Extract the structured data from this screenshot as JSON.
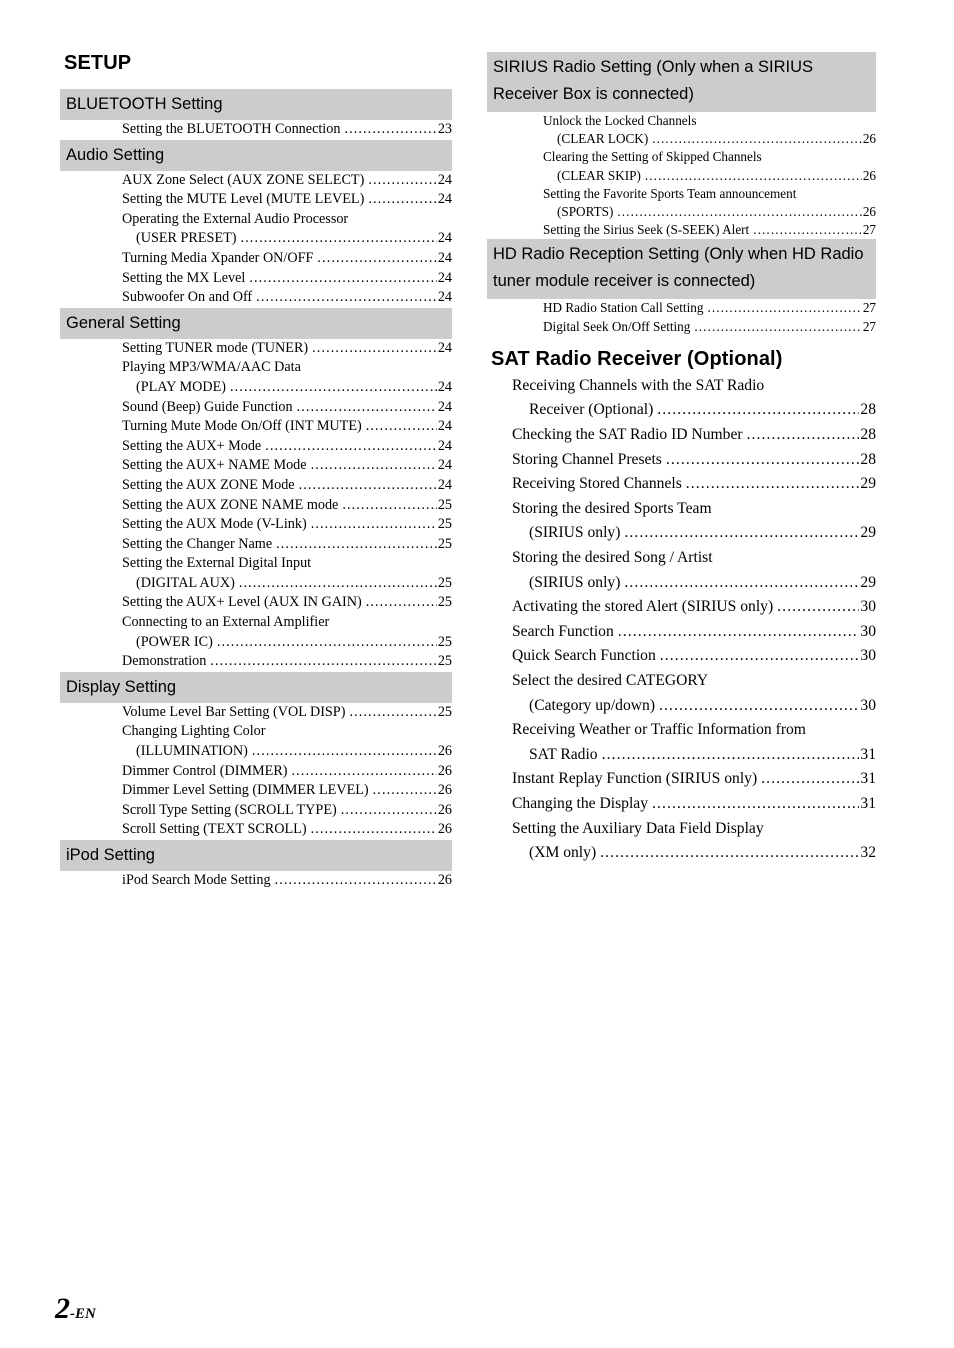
{
  "page": {
    "folio_number": "2",
    "folio_suffix": "-EN",
    "band_color": "#cccccc"
  },
  "left_column": {
    "chapter_title": "SETUP",
    "sections": [
      {
        "heading": "BLUETOOTH Setting",
        "entries": [
          {
            "lines": [
              "Setting the BLUETOOTH Connection"
            ],
            "page": "23"
          }
        ]
      },
      {
        "heading": "Audio Setting",
        "entries": [
          {
            "lines": [
              "AUX Zone Select (AUX ZONE SELECT)"
            ],
            "page": "24"
          },
          {
            "lines": [
              "Setting the MUTE Level (MUTE LEVEL)"
            ],
            "page": "24"
          },
          {
            "lines": [
              "Operating the External Audio Processor",
              "(USER PRESET)"
            ],
            "page": "24"
          },
          {
            "lines": [
              "Turning Media Xpander ON/OFF"
            ],
            "page": "24"
          },
          {
            "lines": [
              "Setting the MX Level"
            ],
            "page": "24"
          },
          {
            "lines": [
              "Subwoofer On and Off"
            ],
            "page": "24"
          }
        ]
      },
      {
        "heading": "General Setting",
        "entries": [
          {
            "lines": [
              "Setting TUNER mode (TUNER)"
            ],
            "page": "24"
          },
          {
            "lines": [
              "Playing MP3/WMA/AAC Data",
              "(PLAY MODE)"
            ],
            "page": "24"
          },
          {
            "lines": [
              "Sound (Beep) Guide Function"
            ],
            "page": "24"
          },
          {
            "lines": [
              "Turning Mute Mode On/Off (INT MUTE)"
            ],
            "page": "24"
          },
          {
            "lines": [
              "Setting the AUX+ Mode"
            ],
            "page": "24"
          },
          {
            "lines": [
              "Setting the AUX+ NAME Mode"
            ],
            "page": "24"
          },
          {
            "lines": [
              "Setting the AUX ZONE Mode"
            ],
            "page": "24"
          },
          {
            "lines": [
              "Setting the AUX ZONE NAME mode"
            ],
            "page": "25"
          },
          {
            "lines": [
              "Setting the AUX Mode (V-Link)"
            ],
            "page": "25"
          },
          {
            "lines": [
              "Setting the Changer Name"
            ],
            "page": "25"
          },
          {
            "lines": [
              "Setting the External Digital Input",
              "(DIGITAL AUX)"
            ],
            "page": "25"
          },
          {
            "lines": [
              "Setting the AUX+ Level (AUX IN GAIN)"
            ],
            "page": "25"
          },
          {
            "lines": [
              "Connecting to an External Amplifier",
              "(POWER IC)"
            ],
            "page": "25"
          },
          {
            "lines": [
              "Demonstration"
            ],
            "page": "25"
          }
        ]
      },
      {
        "heading": "Display Setting",
        "entries": [
          {
            "lines": [
              "Volume Level Bar Setting (VOL DISP)"
            ],
            "page": "25"
          },
          {
            "lines": [
              "Changing Lighting Color",
              "(ILLUMINATION)"
            ],
            "page": "26"
          },
          {
            "lines": [
              "Dimmer Control (DIMMER)"
            ],
            "page": "26"
          },
          {
            "lines": [
              "Dimmer Level Setting (DIMMER LEVEL)"
            ],
            "page": "26"
          },
          {
            "lines": [
              "Scroll Type Setting (SCROLL TYPE)"
            ],
            "page": "26"
          },
          {
            "lines": [
              "Scroll Setting (TEXT SCROLL)"
            ],
            "page": "26"
          }
        ]
      },
      {
        "heading": "iPod Setting",
        "entries": [
          {
            "lines": [
              "iPod Search Mode Setting"
            ],
            "page": "26"
          }
        ]
      }
    ]
  },
  "right_column": {
    "sections": [
      {
        "heading": "SIRIUS Radio Setting (Only when a SIRIUS Receiver Box is connected)",
        "entries": [
          {
            "lines": [
              "Unlock the Locked Channels",
              "(CLEAR LOCK)"
            ],
            "page": "26"
          },
          {
            "lines": [
              "Clearing the Setting of Skipped Channels",
              "(CLEAR SKIP)"
            ],
            "page": "26"
          },
          {
            "lines": [
              "Setting the Favorite Sports Team announcement",
              "(SPORTS)"
            ],
            "page": "26"
          },
          {
            "lines": [
              "Setting the Sirius Seek (S-SEEK) Alert"
            ],
            "page": "27"
          }
        ]
      },
      {
        "heading": "HD Radio Reception Setting (Only when HD Radio tuner module receiver is connected)",
        "entries": [
          {
            "lines": [
              "HD Radio Station Call Setting"
            ],
            "page": "27"
          },
          {
            "lines": [
              "Digital Seek On/Off Setting"
            ],
            "page": "27"
          }
        ]
      }
    ],
    "chapter_title": "SAT Radio Receiver (Optional)",
    "chapter_entries": [
      {
        "lines": [
          "Receiving Channels with the SAT Radio",
          "Receiver (Optional)"
        ],
        "page": "28"
      },
      {
        "lines": [
          "Checking the SAT Radio ID Number"
        ],
        "page": "28"
      },
      {
        "lines": [
          "Storing Channel Presets"
        ],
        "page": "28"
      },
      {
        "lines": [
          "Receiving Stored Channels"
        ],
        "page": "29"
      },
      {
        "lines": [
          "Storing the desired Sports Team",
          "(SIRIUS only)"
        ],
        "page": "29"
      },
      {
        "lines": [
          "Storing the desired Song / Artist",
          "(SIRIUS only)"
        ],
        "page": "29"
      },
      {
        "lines": [
          "Activating the stored Alert (SIRIUS only)"
        ],
        "page": "30"
      },
      {
        "lines": [
          "Search Function"
        ],
        "page": "30"
      },
      {
        "lines": [
          "Quick Search Function"
        ],
        "page": "30"
      },
      {
        "lines": [
          "Select the desired CATEGORY",
          "(Category up/down)"
        ],
        "page": "30"
      },
      {
        "lines": [
          "Receiving Weather or Traffic Information from",
          "SAT Radio"
        ],
        "page": "31"
      },
      {
        "lines": [
          "Instant Replay Function (SIRIUS only)"
        ],
        "page": "31"
      },
      {
        "lines": [
          "Changing the Display"
        ],
        "page": "31"
      },
      {
        "lines": [
          "Setting the Auxiliary Data Field Display",
          "(XM only)"
        ],
        "page": "32"
      }
    ]
  }
}
